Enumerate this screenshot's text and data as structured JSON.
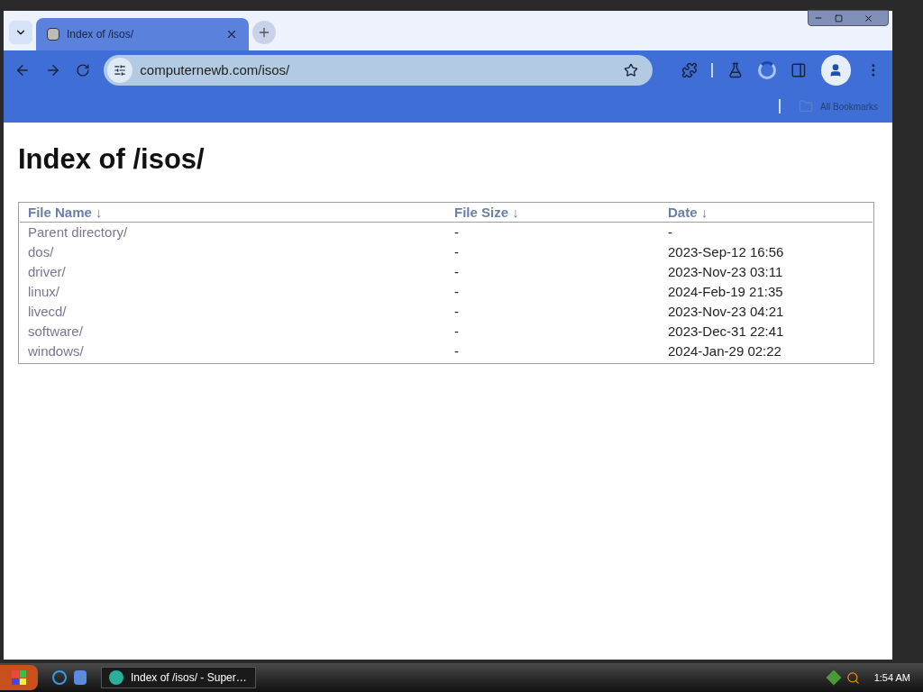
{
  "tabs": [
    {
      "title": "Index of /isos/",
      "selected": true
    }
  ],
  "address": "computernewb.com/isos/",
  "bookmarks_bar": {
    "label": "All Bookmarks"
  },
  "page": {
    "heading": "Index of /isos/",
    "columns": [
      "File Name ↓",
      "File Size ↓",
      "Date ↓"
    ],
    "rows": [
      {
        "name": "Parent directory/",
        "size": "-",
        "date": "-"
      },
      {
        "name": "dos/",
        "size": "-",
        "date": "2023-Sep-12 16:56"
      },
      {
        "name": "driver/",
        "size": "-",
        "date": "2023-Nov-23 03:11"
      },
      {
        "name": "linux/",
        "size": "-",
        "date": "2024-Feb-19 21:35"
      },
      {
        "name": "livecd/",
        "size": "-",
        "date": "2023-Nov-23 04:21"
      },
      {
        "name": "software/",
        "size": "-",
        "date": "2023-Dec-31 22:41"
      },
      {
        "name": "windows/",
        "size": "-",
        "date": "2024-Jan-29 02:22"
      }
    ]
  },
  "taskbar": {
    "tasks": [
      {
        "title": "Index of /isos/ - Super…",
        "selected": true
      }
    ],
    "clock": "1:54 AM"
  }
}
